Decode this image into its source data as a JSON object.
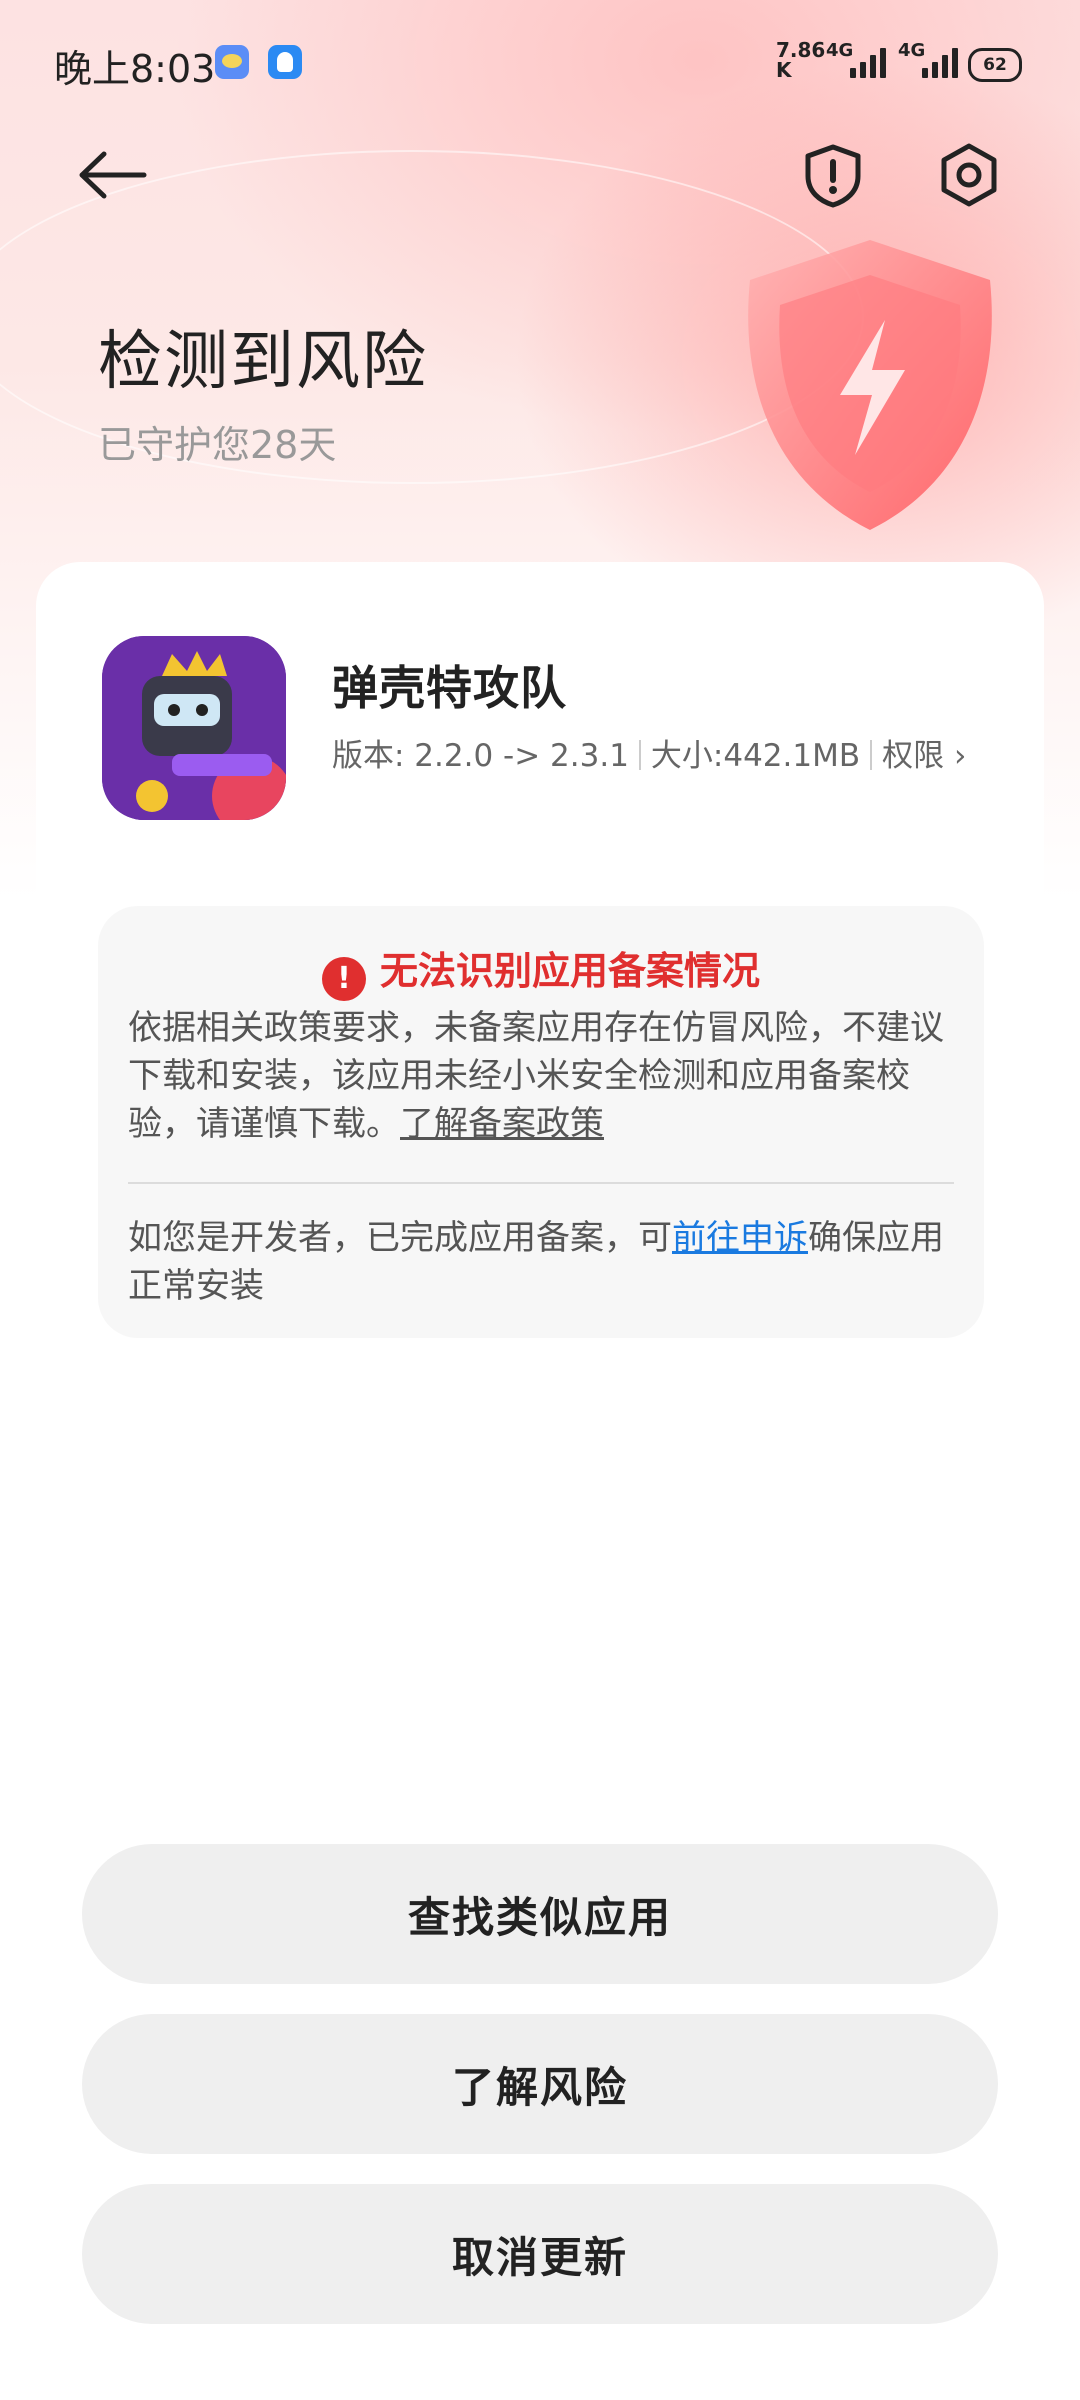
{
  "status_bar": {
    "time": "晚上8:03",
    "net_speed_value": "7.86",
    "net_speed_unit": "K",
    "signal1_label": "4G",
    "signal2_label": "4G",
    "battery": "62"
  },
  "header": {
    "title": "检测到风险",
    "subtitle": "已守护您28天"
  },
  "app": {
    "name": "弹壳特攻队",
    "version": "版本: 2.2.0 -> 2.3.1",
    "size": "大小:442.1MB",
    "permissions_label": "权限",
    "permissions_chevron": "›"
  },
  "warning": {
    "title": "无法识别应用备案情况",
    "body": "依据相关政策要求，未备案应用存在仿冒风险，不建议下载和安装，该应用未经小米安全检测和应用备案校验，请谨慎下载。",
    "policy_link": "了解备案政策",
    "dev_prefix": "如您是开发者，已完成应用备案，可",
    "appeal_link": "前往申诉",
    "dev_suffix": "确保应用正常安装"
  },
  "buttons": {
    "find_similar": "查找类似应用",
    "learn_risk": "了解风险",
    "cancel_update": "取消更新"
  },
  "colors": {
    "danger": "#e02f2f",
    "link": "#1a7ae0",
    "button_bg": "#efefef"
  }
}
